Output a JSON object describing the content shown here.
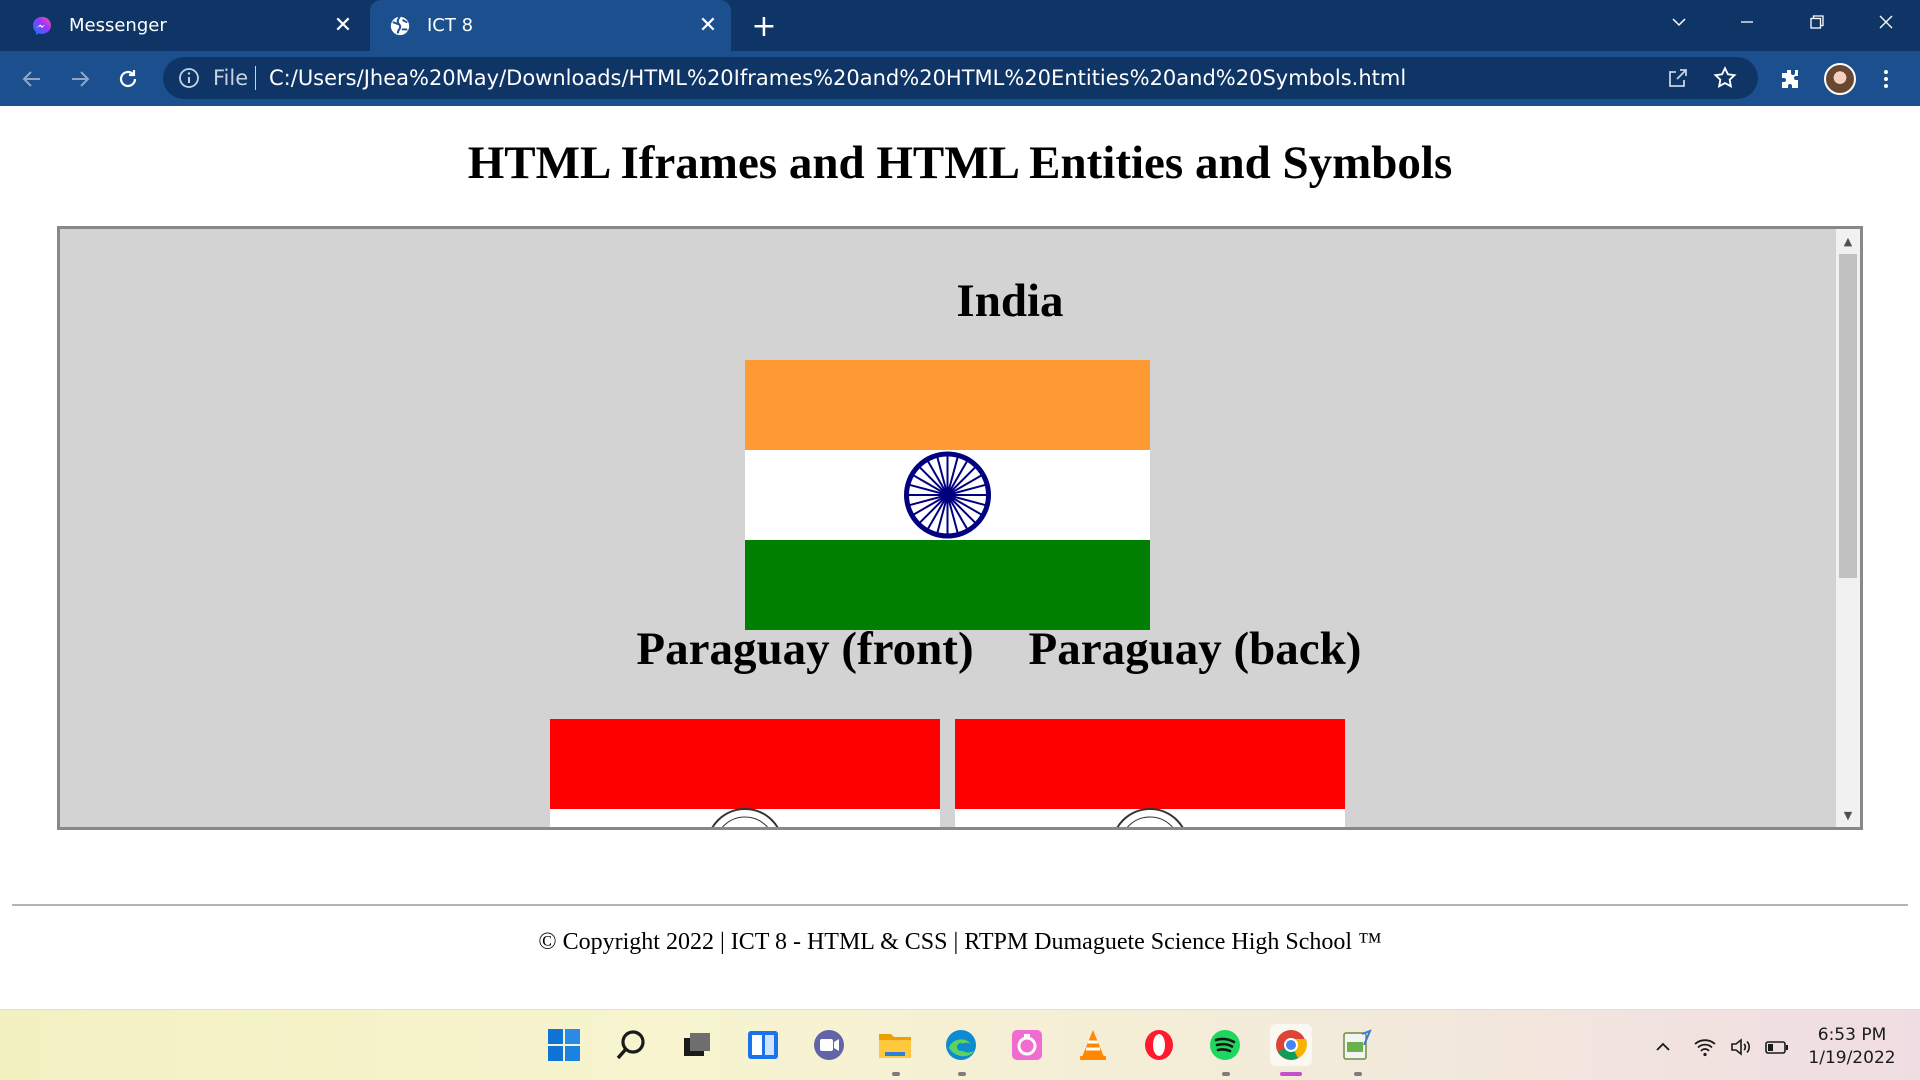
{
  "browser": {
    "tabs": [
      {
        "title": "Messenger",
        "active": false,
        "icon": "messenger-icon"
      },
      {
        "title": "ICT 8",
        "active": true,
        "icon": "globe-icon"
      }
    ],
    "address_bar": {
      "scheme_label": "File",
      "url": "C:/Users/Jhea%20May/Downloads/HTML%20Iframes%20and%20HTML%20Entities%20and%20Symbols.html"
    }
  },
  "page": {
    "title": "HTML Iframes and HTML Entities and Symbols",
    "iframe": {
      "heading_india": "India",
      "heading_paraguay_front": "Paraguay (front)",
      "heading_paraguay_back": "Paraguay (back)",
      "colors": {
        "background": "#d3d3d3",
        "india_saffron": "#ff9933",
        "india_white": "#ffffff",
        "india_green": "#138808",
        "ashoka_chakra": "#000080",
        "paraguay_red": "#ff0000"
      },
      "scroll_position": 0.0
    },
    "footer": "© Copyright 2022 | ICT 8 - HTML & CSS | RTPM Dumaguete Science High School ™"
  },
  "taskbar": {
    "pinned_apps": [
      "start-icon",
      "search-icon",
      "task-view-icon",
      "widgets-icon",
      "chat-icon",
      "file-explorer-icon",
      "edge-icon",
      "photos-icon",
      "vlc-icon",
      "opera-icon",
      "spotify-icon",
      "chrome-icon",
      "notepad-icon"
    ],
    "clock": {
      "time": "6:53 PM",
      "date": "1/19/2022"
    }
  }
}
